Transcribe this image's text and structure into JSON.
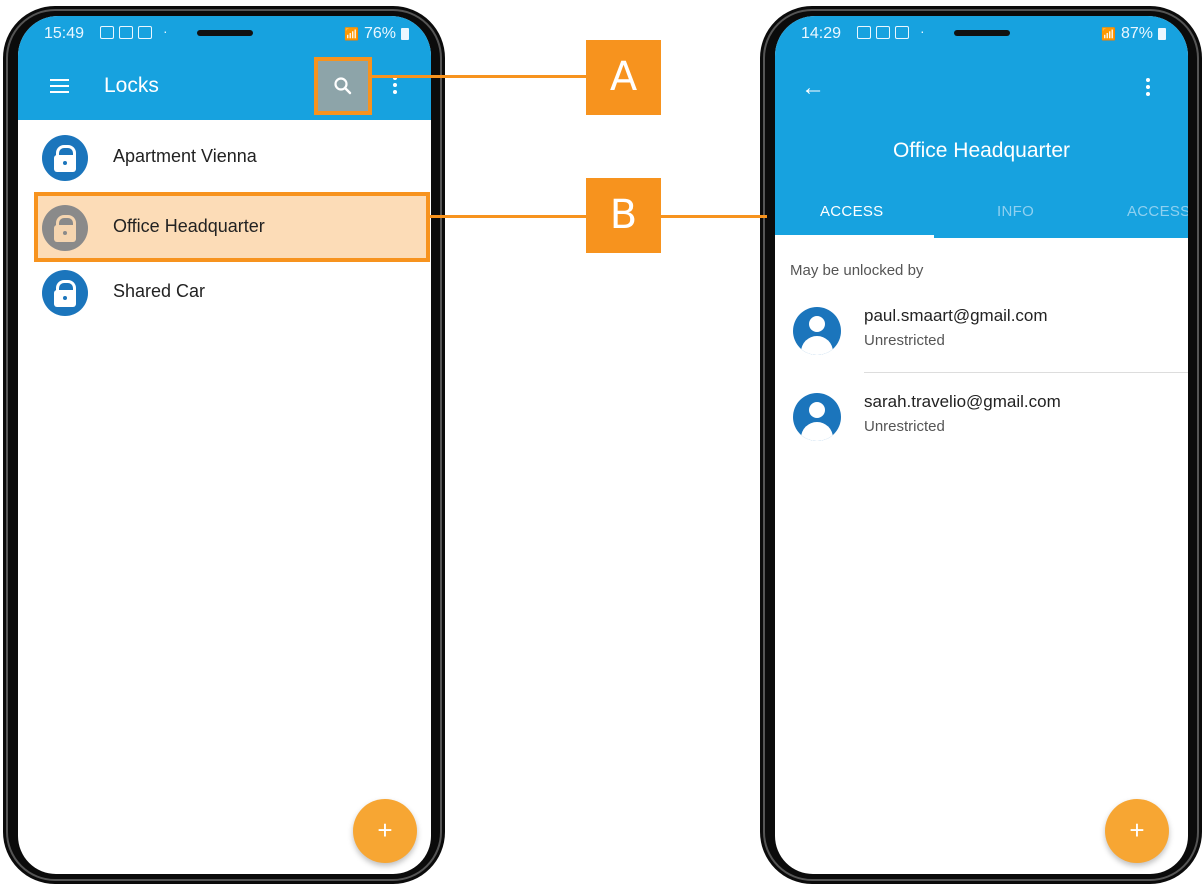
{
  "left_phone": {
    "status": {
      "time": "15:49",
      "battery": "76%"
    },
    "appbar": {
      "title": "Locks",
      "menu_icon": "hamburger-icon",
      "search_icon": "search-icon",
      "overflow_icon": "more-vert-icon"
    },
    "locks": [
      {
        "label": "Apartment Vienna",
        "icon": "lock-icon"
      },
      {
        "label": "Office Headquarter",
        "icon": "lock-icon"
      },
      {
        "label": "Shared Car",
        "icon": "lock-icon"
      }
    ],
    "fab": {
      "label": "+",
      "icon": "add-icon"
    }
  },
  "right_phone": {
    "status": {
      "time": "14:29",
      "battery": "87%"
    },
    "header": {
      "back_icon": "arrow-back-icon",
      "title": "Office Headquarter",
      "overflow_icon": "more-vert-icon"
    },
    "tabs": [
      {
        "label": "ACCESS",
        "active": true
      },
      {
        "label": "INFO",
        "active": false
      },
      {
        "label": "ACCESS",
        "active": false
      }
    ],
    "section_label": "May be unlocked by",
    "users": [
      {
        "email": "paul.smaart@gmail.com",
        "status": "Unrestricted",
        "icon": "account-circle-icon"
      },
      {
        "email": "sarah.travelio@gmail.com",
        "status": "Unrestricted",
        "icon": "account-circle-icon"
      }
    ],
    "fab": {
      "label": "+",
      "icon": "add-icon"
    }
  },
  "callouts": {
    "a": "A",
    "b": "B"
  },
  "colors": {
    "primary": "#17a2df",
    "accent": "#f7931e",
    "lock_blue": "#1b75bc",
    "fab": "#f7a633"
  }
}
